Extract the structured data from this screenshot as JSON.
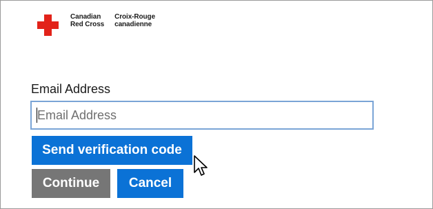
{
  "brand": {
    "name_en_line1": "Canadian",
    "name_en_line2": "Red Cross",
    "name_fr_line1": "Croix-Rouge",
    "name_fr_line2": "canadienne",
    "logo_color": "#e2231a"
  },
  "form": {
    "email_label": "Email Address",
    "email_placeholder": "Email Address",
    "email_value": ""
  },
  "buttons": {
    "send_code": "Send verification code",
    "continue": "Continue",
    "cancel": "Cancel"
  },
  "colors": {
    "primary": "#0b72d6",
    "disabled": "#767676",
    "input_border": "#7aa4d6"
  },
  "icons": {
    "pointer": "mouse-pointer-icon",
    "logo": "red-cross-icon"
  }
}
